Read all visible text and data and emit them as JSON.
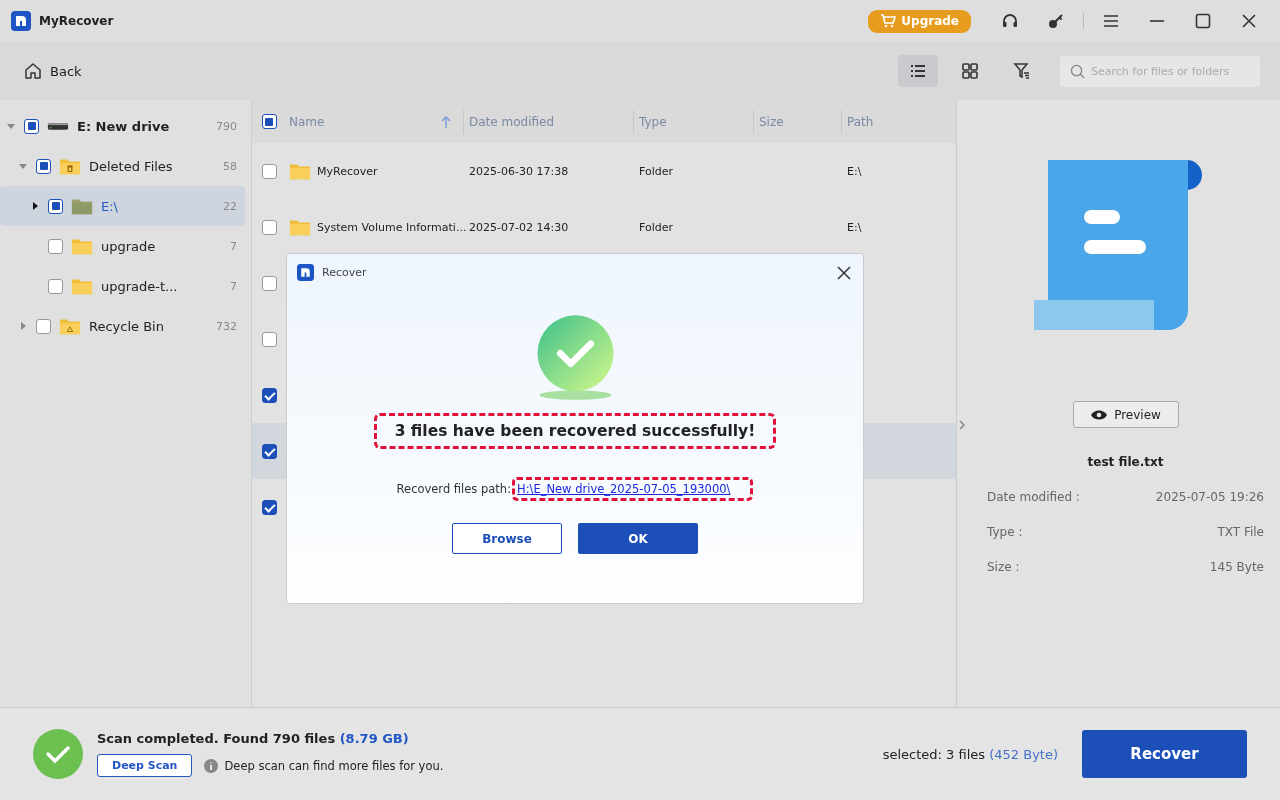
{
  "window": {
    "title": "MyRecover",
    "upgrade": "Upgrade"
  },
  "toolbar": {
    "back": "Back",
    "views": [
      {
        "kind": "list",
        "selected": true
      },
      {
        "kind": "grid",
        "selected": false
      },
      {
        "kind": "filter",
        "selected": false
      }
    ],
    "search": {
      "placeholder": "Search for files or folders"
    }
  },
  "tree": [
    {
      "label": "E: New drive",
      "count": "790",
      "kind": "drive",
      "checked": false,
      "partial": true,
      "expanded": true,
      "selected": false,
      "children": [
        {
          "label": "Deleted Files",
          "count": "58",
          "kind": "trash-folder",
          "checked": false,
          "partial": true,
          "expanded": true,
          "selected": false,
          "children": [
            {
              "label": "E:\\",
              "count": "22",
              "kind": "folder",
              "checked": false,
              "partial": true,
              "expanded": false,
              "selected": true
            },
            {
              "label": "upgrade",
              "count": "7",
              "kind": "folder",
              "checked": false,
              "partial": false,
              "selected": false
            },
            {
              "label": "upgrade-t...",
              "count": "7",
              "kind": "folder",
              "checked": false,
              "partial": false,
              "selected": false
            }
          ]
        },
        {
          "label": "Recycle Bin",
          "count": "732",
          "kind": "recycle-folder",
          "checked": false,
          "partial": false,
          "expanded": false,
          "selected": false
        }
      ]
    }
  ],
  "table": {
    "header_checked": false,
    "header_partial": true,
    "columns": [
      {
        "label": "Name",
        "sorted": true
      },
      {
        "label": "Date modified",
        "sorted": false
      },
      {
        "label": "Type",
        "sorted": false
      },
      {
        "label": "Size",
        "sorted": false
      },
      {
        "label": "Path",
        "sorted": false
      }
    ],
    "rows": [
      {
        "checked": false,
        "selected": false,
        "name": "MyRecover",
        "date": "2025-06-30 17:38",
        "type": "Folder",
        "path": "E:\\"
      },
      {
        "checked": false,
        "selected": false,
        "name": "System Volume Informati...",
        "date": "2025-07-02 14:30",
        "type": "Folder",
        "path": "E:\\"
      },
      {
        "checked": false,
        "selected": false
      },
      {
        "checked": false,
        "selected": false
      },
      {
        "checked": true,
        "selected": false
      },
      {
        "checked": true,
        "selected": true
      },
      {
        "checked": true,
        "selected": false
      }
    ]
  },
  "details": {
    "preview": "Preview",
    "file_name": "test file.txt",
    "fields": [
      {
        "label": "Date modified :",
        "value": "2025-07-05 19:26"
      },
      {
        "label": "Type :",
        "value": "TXT File"
      },
      {
        "label": "Size :",
        "value": "145 Byte"
      }
    ]
  },
  "dialog": {
    "title": "Recover",
    "message": "3 files have been recovered successfully!",
    "path_label": "Recoverd files path:",
    "path": "H:\\E_New drive_2025-07-05_193000\\",
    "buttons": [
      {
        "label": "Browse",
        "kind": "secondary"
      },
      {
        "label": "OK",
        "kind": "primary"
      }
    ]
  },
  "status": {
    "summary": "Scan completed. Found 790 files",
    "size": "(8.79 GB)",
    "deep_scan": "Deep Scan",
    "hint": "Deep scan can find more files for you.",
    "selected": "selected: 3 files",
    "selected_size": "(452 Byte)",
    "recover": "Recover"
  }
}
